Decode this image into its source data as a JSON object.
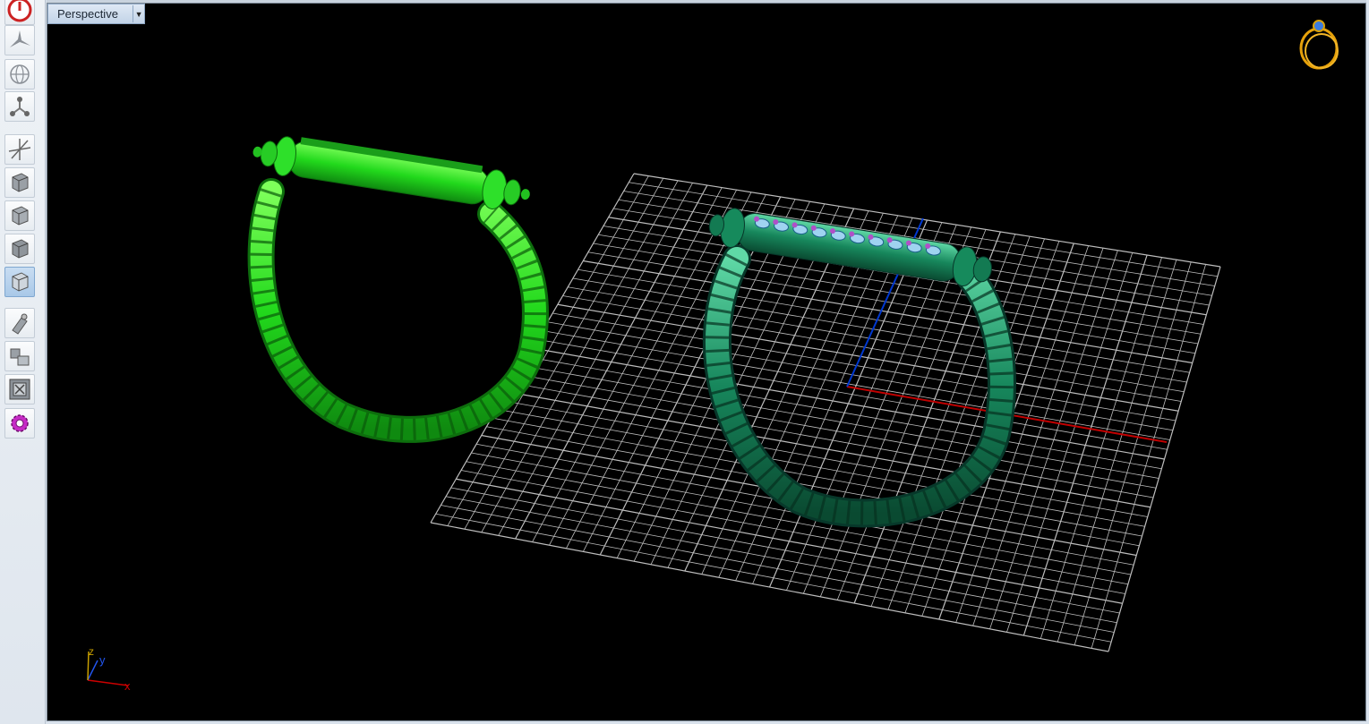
{
  "viewport": {
    "view_name": "Perspective",
    "view_dropdown_icon": "chevron-down-icon"
  },
  "toolbar": {
    "tools": [
      {
        "name": "power-icon"
      },
      {
        "name": "pan-star-icon"
      },
      {
        "name": "globe-rotate-icon"
      },
      {
        "name": "nodes-icon"
      },
      {
        "name": "gumball-icon"
      },
      {
        "name": "cube-view-1-icon"
      },
      {
        "name": "cube-view-2-icon"
      },
      {
        "name": "cube-view-3-icon"
      },
      {
        "name": "cube-view-4-icon"
      },
      {
        "name": "brush-icon"
      },
      {
        "name": "tool-pair-icon"
      },
      {
        "name": "zoom-extents-icon"
      },
      {
        "name": "settings-gear-icon"
      }
    ]
  },
  "axes_widget": {
    "x": "x",
    "y": "y",
    "z": "z"
  },
  "colors": {
    "ring_bright": "#22e622",
    "ring_dark": "#0f7a52",
    "grid": "#bfbfbf",
    "axis_x": "#c00000",
    "axis_y": "#0033cc",
    "gem": "#b050c8"
  }
}
